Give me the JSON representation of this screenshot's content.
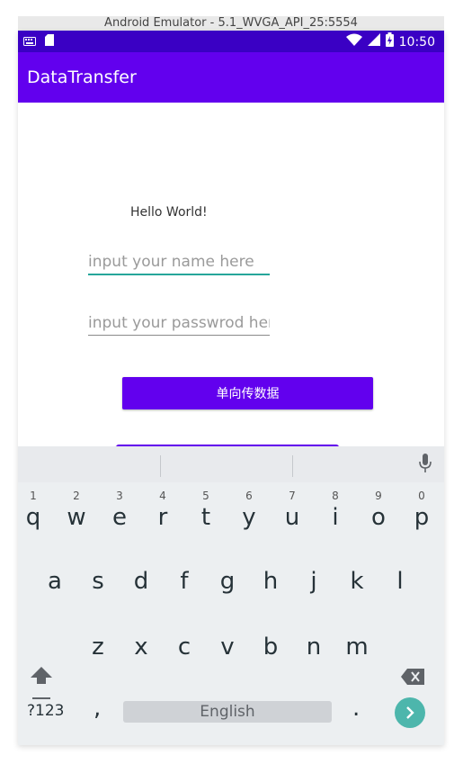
{
  "window": {
    "title": "Android Emulator - 5.1_WVGA_API_25:5554"
  },
  "status_bar": {
    "time": "10:50"
  },
  "app_bar": {
    "title": "DataTransfer"
  },
  "content": {
    "hello_text": "Hello World!",
    "name_field": {
      "placeholder": "input your name here",
      "value": ""
    },
    "password_field": {
      "placeholder": "input your passwrod here",
      "value": ""
    },
    "one_way_button_label": "单向传数据",
    "second_button_label": ""
  },
  "keyboard": {
    "row1": [
      {
        "hint": "1",
        "ch": "q"
      },
      {
        "hint": "2",
        "ch": "w"
      },
      {
        "hint": "3",
        "ch": "e"
      },
      {
        "hint": "4",
        "ch": "r"
      },
      {
        "hint": "5",
        "ch": "t"
      },
      {
        "hint": "6",
        "ch": "y"
      },
      {
        "hint": "7",
        "ch": "u"
      },
      {
        "hint": "8",
        "ch": "i"
      },
      {
        "hint": "9",
        "ch": "o"
      },
      {
        "hint": "0",
        "ch": "p"
      }
    ],
    "row2": [
      "a",
      "s",
      "d",
      "f",
      "g",
      "h",
      "j",
      "k",
      "l"
    ],
    "row3": [
      "z",
      "x",
      "c",
      "v",
      "b",
      "n",
      "m"
    ],
    "symbols_label": "?123",
    "comma": ",",
    "space_label": "English",
    "period": ".",
    "colors": {
      "enter": "#4db6ac",
      "accent": "#6200ee",
      "field_focus": "#26a69a"
    }
  }
}
